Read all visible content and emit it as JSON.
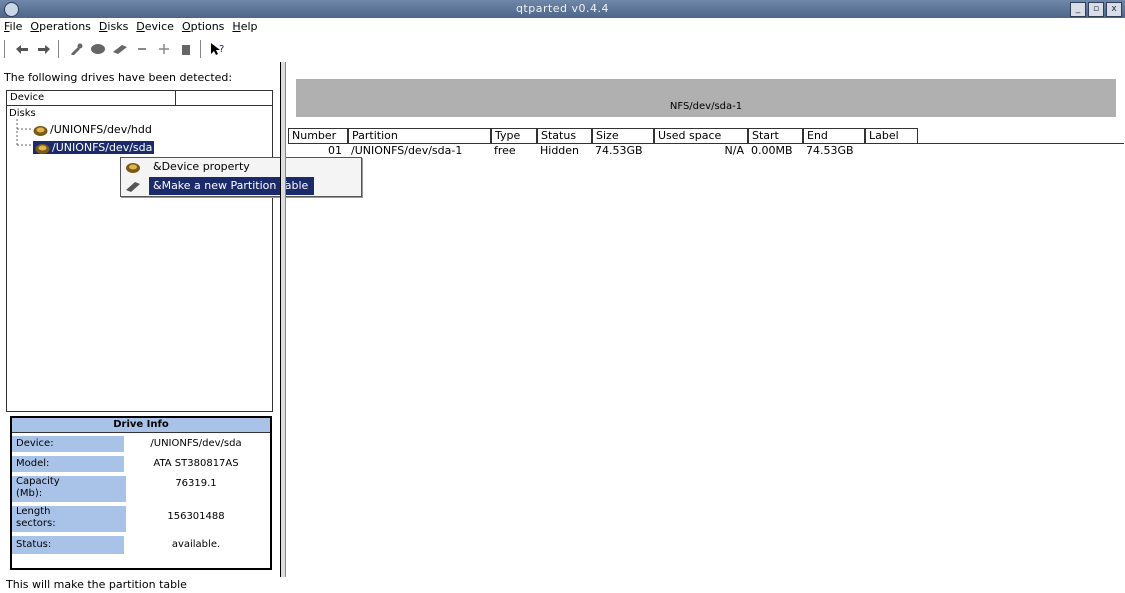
{
  "window": {
    "title": "qtparted v0.4.4",
    "controls": [
      "_",
      "▫",
      "x"
    ]
  },
  "menu": [
    "File",
    "Operations",
    "Disks",
    "Device",
    "Options",
    "Help"
  ],
  "toolbar": {
    "icons": [
      "undo-icon",
      "redo-icon",
      "tool-icon",
      "resize-icon",
      "eraser-icon",
      "minus-icon",
      "move-icon",
      "trash-icon",
      "whatsthis-icon"
    ]
  },
  "left": {
    "detected_label": "The following drives have been detected:",
    "tree_header": "Device",
    "tree_root": "Disks",
    "drive1": "/UNIONFS/dev/hdd",
    "drive2": "/UNIONFS/dev/sda"
  },
  "context_menu": {
    "item1": "&Device property",
    "item2": "&Make a new Partition Table"
  },
  "drive_info": {
    "title": "Drive Info",
    "rows": [
      {
        "k": "Device:",
        "v": "/UNIONFS/dev/sda"
      },
      {
        "k": "Model:",
        "v": "ATA ST380817AS"
      },
      {
        "k": "Capacity (Mb):",
        "v": "76319.1"
      },
      {
        "k": "Length sectors:",
        "v": "156301488"
      },
      {
        "k": "Status:",
        "v": "available."
      }
    ]
  },
  "status_text": "This will make the partition table",
  "partition_graph": {
    "label": "NFS/dev/sda-1",
    "color": "#b0b0b0"
  },
  "table": {
    "headers": [
      "Number",
      "Partition",
      "Type",
      "Status",
      "Size",
      "Used space",
      "Start",
      "End",
      "Label"
    ],
    "rows": [
      [
        "01",
        "/UNIONFS/dev/sda-1",
        "free",
        "Hidden",
        "74.53GB",
        "N/A",
        "0.00MB",
        "74.53GB",
        ""
      ]
    ]
  },
  "colors": {
    "selection": "#1b2a6b",
    "info_key": "#a9c3e8",
    "titlebar": "#5a7396"
  }
}
